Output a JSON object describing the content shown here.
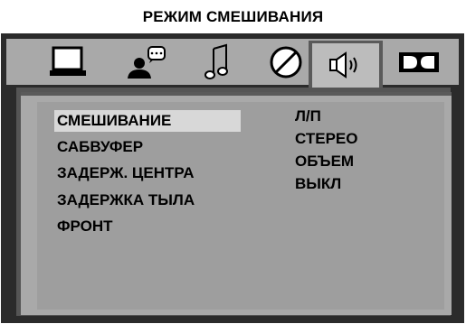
{
  "title": "РЕЖИМ СМЕШИВАНИЯ",
  "tabs": [
    {
      "icon": "monitor-icon",
      "active": false
    },
    {
      "icon": "person-speech-icon",
      "active": false
    },
    {
      "icon": "music-note-icon",
      "active": false
    },
    {
      "icon": "no-entry-icon",
      "active": false
    },
    {
      "icon": "speaker-icon",
      "active": true
    },
    {
      "icon": "dolby-icon",
      "active": false
    }
  ],
  "menu": {
    "items": [
      {
        "label": "СМЕШИВАНИЕ",
        "selected": true
      },
      {
        "label": "САБВУФЕР",
        "selected": false
      },
      {
        "label": "ЗАДЕРЖ. ЦЕНТРА",
        "selected": false
      },
      {
        "label": "ЗАДЕРЖКА ТЫЛА",
        "selected": false
      },
      {
        "label": "ФРОНТ",
        "selected": false
      }
    ]
  },
  "options": {
    "items": [
      {
        "label": "Л/П"
      },
      {
        "label": "СТЕРЕО"
      },
      {
        "label": "ОБЪЕМ"
      },
      {
        "label": "ВЫКЛ"
      }
    ]
  },
  "colors": {
    "frame": "#2b2b2b",
    "tab_strip": "#a9a9a9",
    "panel": "#9e9e9e",
    "highlight": "#d8d8d8"
  }
}
